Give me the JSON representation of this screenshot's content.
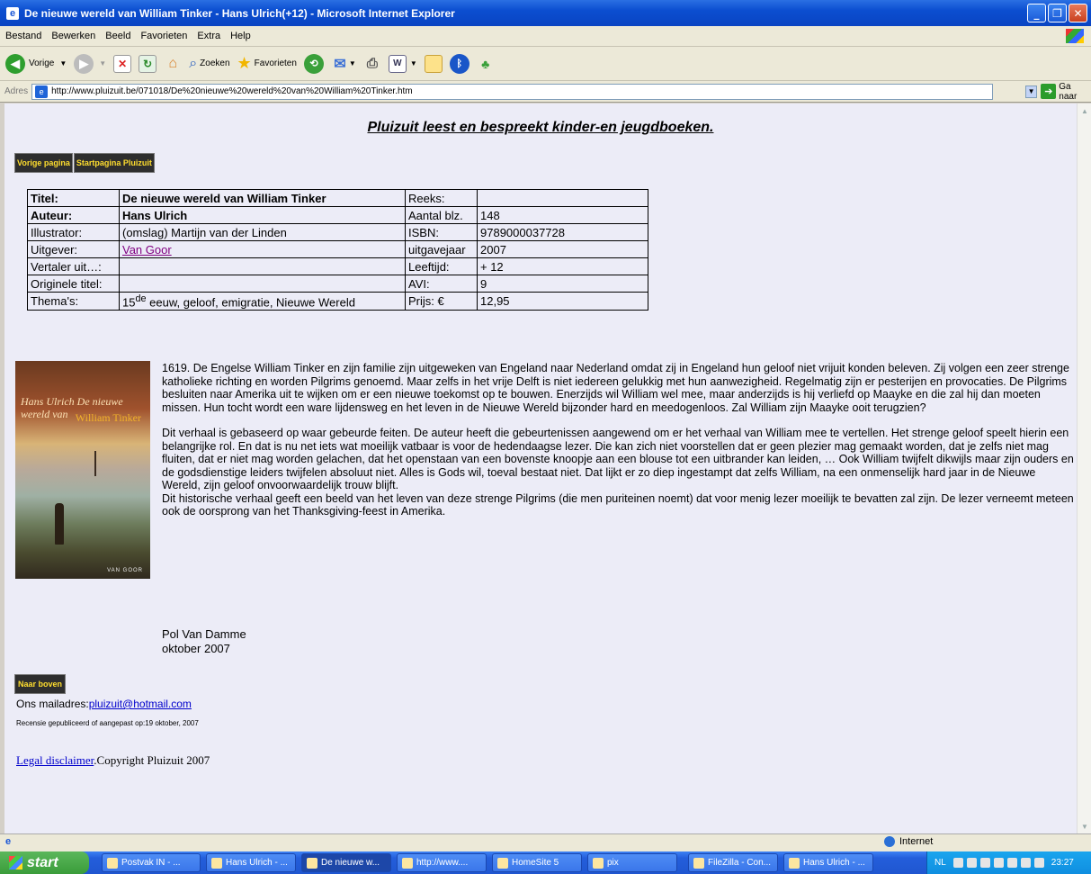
{
  "window": {
    "title": "De nieuwe wereld van William Tinker - Hans Ulrich(+12) - Microsoft Internet Explorer"
  },
  "menu": [
    "Bestand",
    "Bewerken",
    "Beeld",
    "Favorieten",
    "Extra",
    "Help"
  ],
  "toolbar": {
    "back": "Vorige",
    "search": "Zoeken",
    "favorites": "Favorieten"
  },
  "address": {
    "label": "Adres",
    "url": "http://www.pluizuit.be/071018/De%20nieuwe%20wereld%20van%20William%20Tinker.htm",
    "go": "Ga naar"
  },
  "page": {
    "heading": "Pluizuit leest en bespreekt kinder-en jeugdboeken.",
    "nav": {
      "prev": "Vorige pagina",
      "home": "Startpagina Pluizuit"
    },
    "table": {
      "titel_label": "Titel:",
      "titel": "De nieuwe wereld van William Tinker",
      "reeks_label": "Reeks:",
      "reeks": "",
      "auteur_label": "Auteur:",
      "auteur": "Hans Ulrich",
      "blz_label": "Aantal blz.",
      "blz": "148",
      "illustrator_label": "Illustrator:",
      "illustrator": "(omslag) Martijn van der Linden",
      "isbn_label": "ISBN:",
      "isbn": "9789000037728",
      "uitgever_label": "Uitgever:",
      "uitgever": "Van Goor",
      "jaar_label": "uitgavejaar",
      "jaar": "2007",
      "vertaler_label": "Vertaler uit…:",
      "vertaler": "",
      "leeftijd_label": "Leeftijd:",
      "leeftijd": "+ 12",
      "origineel_label": "Originele titel:",
      "origineel": "",
      "avi_label": "AVI:",
      "avi": "9",
      "themas_label": "Thema's:",
      "themas_ord": "15",
      "themas_sup": "de",
      "themas_rest": " eeuw, geloof, emigratie, Nieuwe Wereld",
      "prijs_label": "Prijs: €",
      "prijs": "12,95"
    },
    "cover": {
      "author": "Hans Ulrich",
      "title_a": "De nieuwe",
      "title_b": "wereld van",
      "title_c": "William Tinker",
      "publisher": "VAN GOOR"
    },
    "paragraph1": "1619. De Engelse William Tinker en zijn familie zijn uitgeweken van Engeland naar Nederland omdat zij in Engeland hun geloof niet vrijuit konden beleven. Zij volgen een zeer strenge katholieke richting en worden Pilgrims genoemd. Maar zelfs in het vrije Delft is niet iedereen gelukkig met hun aanwezigheid. Regelmatig zijn er pesterijen en provocaties. De Pilgrims besluiten naar Amerika uit te wijken om er een nieuwe toekomst op te bouwen. Enerzijds wil William wel mee, maar anderzijds is hij verliefd op Maayke en die zal hij dan moeten missen. Hun tocht wordt een ware lijdensweg en het leven in de Nieuwe Wereld bijzonder hard en meedogenloos. Zal William zijn Maayke ooit terugzien?",
    "paragraph2": "Dit verhaal is gebaseerd op waar gebeurde feiten. De auteur heeft die gebeurtenissen aangewend om er het verhaal van William mee te vertellen. Het strenge geloof speelt hierin een belangrijke rol. En dat is nu net iets wat moeilijk vatbaar is voor de hedendaagse lezer. Die kan zich niet voorstellen dat er geen plezier mag gemaakt worden, dat je zelfs niet mag fluiten, dat er niet mag worden gelachen, dat het openstaan van een bovenste knoopje aan een blouse tot een uitbrander kan leiden, … Ook William twijfelt dikwijls maar zijn ouders en de godsdienstige leiders twijfelen absoluut niet. Alles is Gods wil, toeval bestaat niet. Dat lijkt er zo diep ingestampt dat zelfs William, na een onmenselijk hard jaar in de Nieuwe Wereld, zijn geloof onvoorwaardelijk trouw blijft.",
    "paragraph3": "Dit historische verhaal geeft een beeld van het leven van deze strenge Pilgrims (die men puriteinen noemt) dat voor menig lezer moeilijk te bevatten zal zijn. De lezer verneemt meteen ook de oorsprong van het Thanksgiving-feest in Amerika.",
    "reviewer": "Pol Van Damme",
    "date": "oktober 2007",
    "top_button": "Naar boven",
    "mail_label": "Ons mailadres:",
    "mail": "pluizuit@hotmail.com",
    "published": "Recensie gepubliceerd of aangepast op:19 oktober, 2007",
    "legal_link": "Legal disclaimer",
    "copyright": ".Copyright Pluizuit 2007"
  },
  "status": {
    "zone": "Internet"
  },
  "taskbar": {
    "start": "start",
    "items": [
      "Postvak IN - ...",
      "Hans Ulrich - ...",
      "De nieuwe w...",
      "http://www....",
      "HomeSite 5",
      "pix",
      "FileZilla - Con...",
      "Hans Ulrich - ..."
    ],
    "lang": "NL",
    "clock": "23:27"
  }
}
